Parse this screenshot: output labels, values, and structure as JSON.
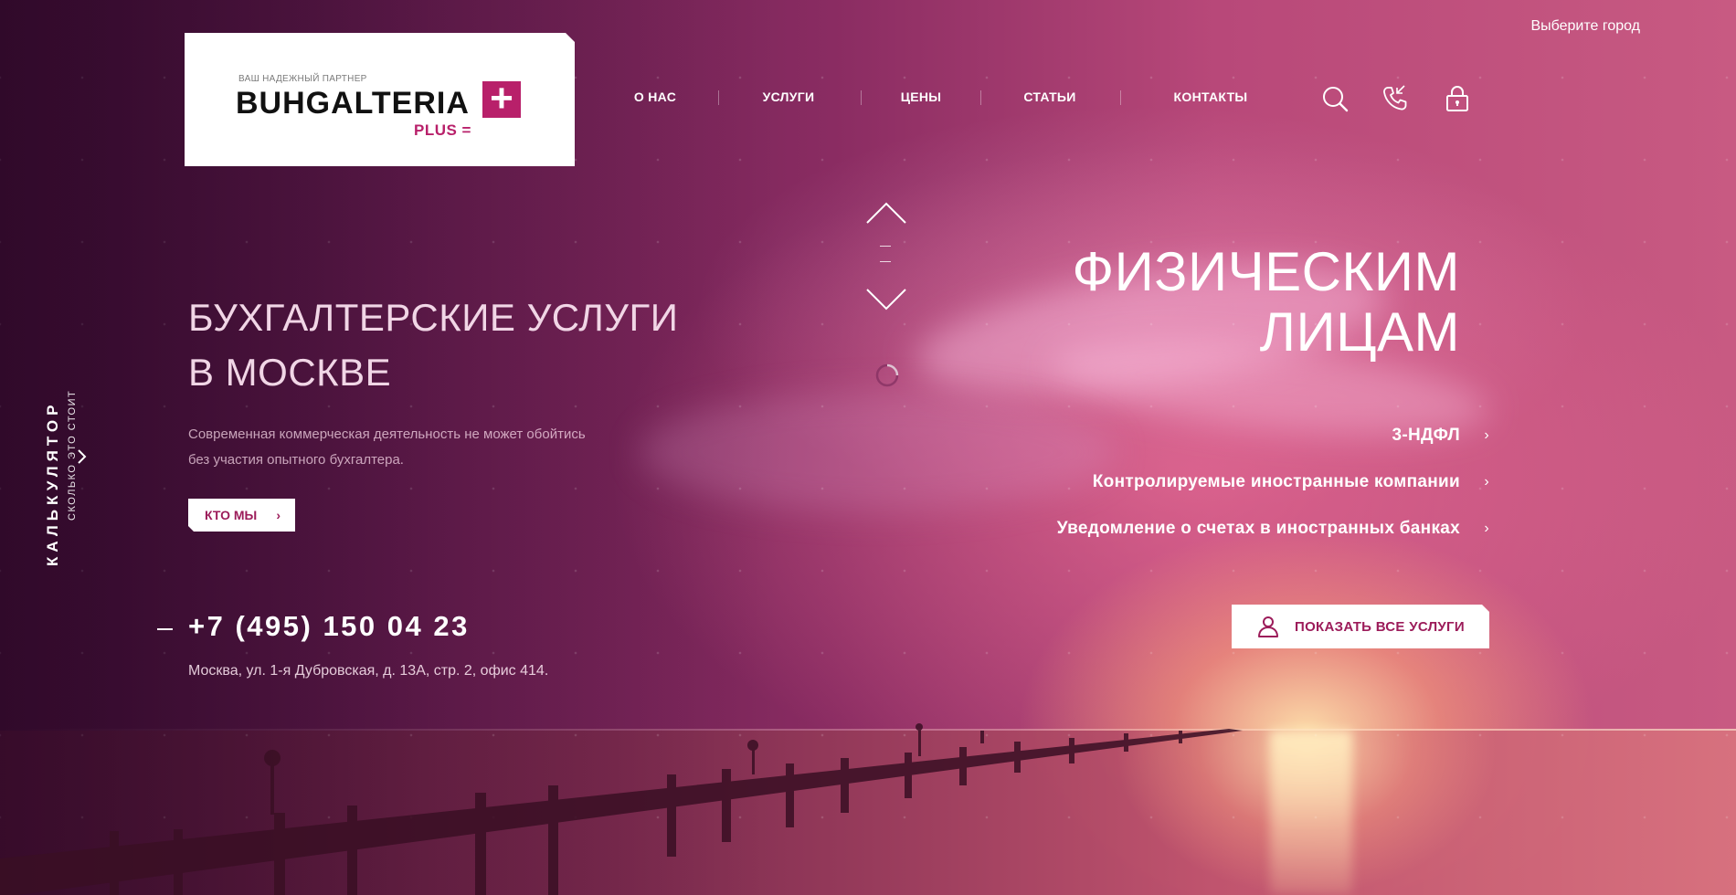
{
  "header": {
    "city_select": "Выберите город",
    "logo": {
      "tagline": "ВАШ НАДЕЖНЫЙ ПАРТНЕР",
      "name": "BUHGALTERIA",
      "plus_sign": "+",
      "sub": "PLUS ="
    },
    "nav": [
      {
        "label": "О НАС"
      },
      {
        "label": "УСЛУГИ"
      },
      {
        "label": "ЦЕНЫ"
      },
      {
        "label": "СТАТЬИ"
      },
      {
        "label": "КОНТАКТЫ"
      }
    ],
    "icons": [
      "search-icon",
      "phone-icon",
      "lock-icon"
    ]
  },
  "calculator": {
    "title": "КАЛЬКУЛЯТОР",
    "subtitle": "СКОЛЬКО ЭТО СТОИТ"
  },
  "hero": {
    "title_line1": "БУХГАЛТЕРСКИЕ УСЛУГИ",
    "title_line2": "В МОСКВЕ",
    "desc_line1": "Современная коммерческая деятельность не может обойтись",
    "desc_line2": "без участия опытного бухгалтера.",
    "button_label": "КТО МЫ",
    "phone": "+7 (495) 150 04 23",
    "address": "Москва, ул. 1-я Дубровская, д. 13А, стр. 2, офис 414."
  },
  "slide": {
    "title_line1": "ФИЗИЧЕСКИМ",
    "title_line2": "ЛИЦАМ",
    "services": [
      {
        "label": "3-НДФЛ"
      },
      {
        "label": "Контролируемые иностранные компании"
      },
      {
        "label": "Уведомление о счетах в иностранных банках"
      }
    ],
    "all_services_button": "ПОКАЗАТЬ ВСЕ УСЛУГИ"
  },
  "colors": {
    "brand": "#b8206a",
    "button_text": "#9c1c5a"
  }
}
